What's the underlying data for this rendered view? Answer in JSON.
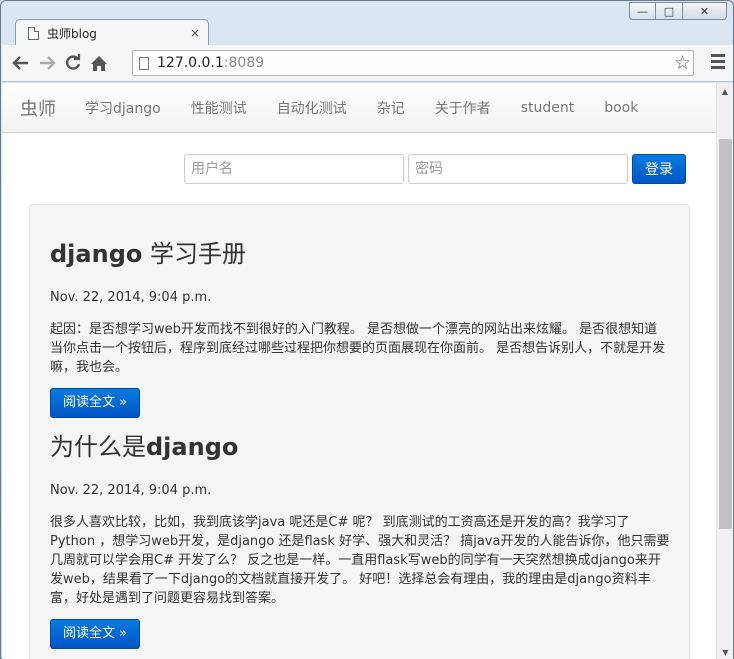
{
  "browser": {
    "tab_title": "虫师blog",
    "tab_close": "×",
    "url_host": "127.0.0.1",
    "url_port": ":8089",
    "window_controls": {
      "minimize": "—",
      "maximize": "□",
      "close": "✕"
    }
  },
  "navbar": {
    "brand": "虫师",
    "items": [
      "学习django",
      "性能测试",
      "自动化测试",
      "杂记",
      "关于作者",
      "student",
      "book"
    ]
  },
  "login": {
    "username_placeholder": "用户名",
    "password_placeholder": "密码",
    "submit_label": "登录"
  },
  "posts": [
    {
      "title_latin": "django",
      "title_cjk": " 学习手册",
      "date": "Nov. 22, 2014, 9:04 p.m.",
      "body": "起因：是否想学习web开发而找不到很好的入门教程。 是否想做一个漂亮的网站出来炫耀。 是否很想知道当你点击一个按钮后，程序到底经过哪些过程把你想要的页面展现在你面前。 是否想告诉别人，不就是开发嘛，我也会。",
      "read_more": "阅读全文 »"
    },
    {
      "title_cjk": "为什么是",
      "title_latin": "django",
      "date": "Nov. 22, 2014, 9:04 p.m.",
      "body": "很多人喜欢比较，比如，我到底该学java 呢还是C# 呢？ 到底测试的工资高还是开发的高？我学习了Python ，想学习web开发，是django 还是flask 好学、强大和灵活？ 搞java开发的人能告诉你，他只需要几周就可以学会用C# 开发了么？ 反之也是一样。一直用flask写web的同学有一天突然想换成django来开发web，结果看了一下django的文档就直接开发了。 好吧！选择总会有理由，我的理由是django资料丰富，好处是遇到了问题更容易找到答案。",
      "read_more": "阅读全文 »"
    }
  ]
}
